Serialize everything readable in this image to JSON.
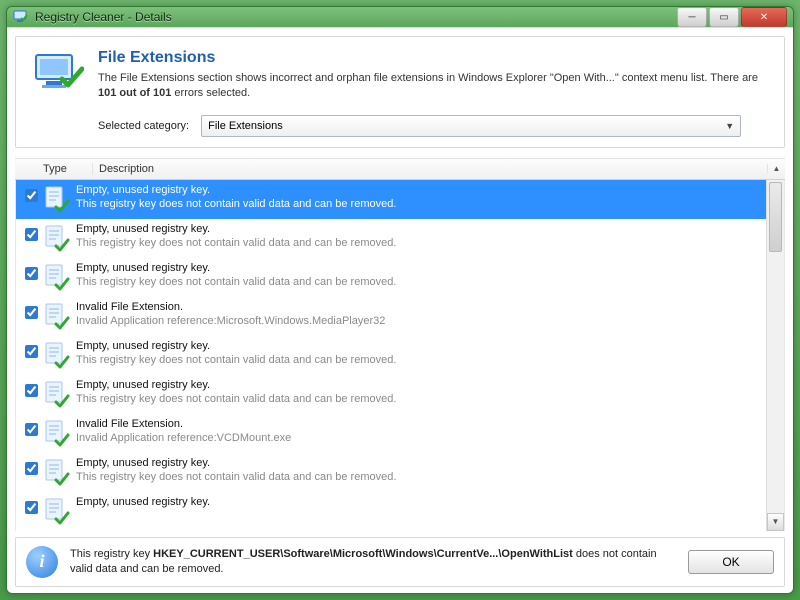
{
  "titlebar": {
    "title": "Registry Cleaner - Details"
  },
  "header": {
    "heading": "File Extensions",
    "desc_pre": "The File Extensions section shows incorrect and orphan file extensions in Windows Explorer \"Open With...\" context menu list. There are ",
    "desc_bold": "101 out of 101",
    "desc_post": " errors selected.",
    "category_label": "Selected category:",
    "category_value": "File Extensions"
  },
  "columns": {
    "type": "Type",
    "description": "Description"
  },
  "rows": [
    {
      "checked": true,
      "selected": true,
      "title": "Empty, unused registry key.",
      "detail": "This registry key does not contain valid data and can be removed."
    },
    {
      "checked": true,
      "selected": false,
      "title": "Empty, unused registry key.",
      "detail": "This registry key does not contain valid data and can be removed."
    },
    {
      "checked": true,
      "selected": false,
      "title": "Empty, unused registry key.",
      "detail": "This registry key does not contain valid data and can be removed."
    },
    {
      "checked": true,
      "selected": false,
      "title": "Invalid File Extension.",
      "detail": "Invalid Application reference:Microsoft.Windows.MediaPlayer32"
    },
    {
      "checked": true,
      "selected": false,
      "title": "Empty, unused registry key.",
      "detail": "This registry key does not contain valid data and can be removed."
    },
    {
      "checked": true,
      "selected": false,
      "title": "Empty, unused registry key.",
      "detail": "This registry key does not contain valid data and can be removed."
    },
    {
      "checked": true,
      "selected": false,
      "title": "Invalid File Extension.",
      "detail": "Invalid Application reference:VCDMount.exe"
    },
    {
      "checked": true,
      "selected": false,
      "title": "Empty, unused registry key.",
      "detail": "This registry key does not contain valid data and can be removed."
    },
    {
      "checked": true,
      "selected": false,
      "title": "Empty, unused registry key.",
      "detail": ""
    }
  ],
  "footer": {
    "pre": "This registry key ",
    "bold": "HKEY_CURRENT_USER\\Software\\Microsoft\\Windows\\CurrentVe...\\OpenWithList",
    "post": " does not contain valid data and can be removed.",
    "ok": "OK"
  },
  "icons": {
    "app_monitor_stroke": "#2e7ad1",
    "app_monitor_fill": "#cfe7ff",
    "app_check": "#2fa82f"
  }
}
